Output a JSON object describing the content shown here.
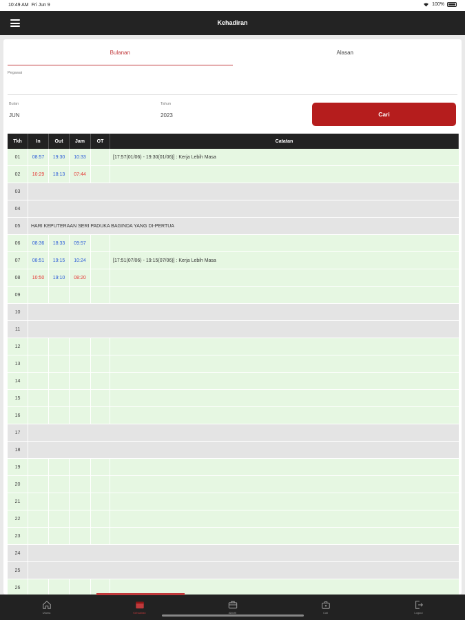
{
  "status": {
    "time": "10:49 AM",
    "date": "Fri Jun 9",
    "battery": "100%"
  },
  "header": {
    "title": "Kehadiran"
  },
  "tabs": [
    {
      "label": "Bulanan"
    },
    {
      "label": "Alasan"
    }
  ],
  "form": {
    "pegawai_label": "Pegawai",
    "pegawai_value": "",
    "bulan_label": "Bulan",
    "bulan_value": "JUN",
    "tahun_label": "Tahun",
    "tahun_value": "2023",
    "cari_label": "Cari"
  },
  "table": {
    "headers": {
      "tkh": "Tkh",
      "in": "In",
      "out": "Out",
      "jam": "Jam",
      "ot": "OT",
      "catatan": "Catatan"
    },
    "rows": [
      {
        "tkh": "01",
        "in": "08:57",
        "out": "19:30",
        "jam": "10:33",
        "ot": "",
        "catatan": "[17:57(01/06) - 19:30(01/06)] : Kerja Lebih Masa"
      },
      {
        "tkh": "02",
        "in": "10:29",
        "out": "18:13",
        "jam": "07:44",
        "ot": "",
        "catatan": ""
      },
      {
        "tkh": "03",
        "holiday": ""
      },
      {
        "tkh": "04",
        "holiday": ""
      },
      {
        "tkh": "05",
        "holiday": "HARI KEPUTERAAN SERI PADUKA BAGINDA YANG DI-PERTUA"
      },
      {
        "tkh": "06",
        "in": "08:36",
        "out": "18:33",
        "jam": "09:57",
        "ot": "",
        "catatan": ""
      },
      {
        "tkh": "07",
        "in": "08:51",
        "out": "19:15",
        "jam": "10:24",
        "ot": "",
        "catatan": "[17:51(07/06) - 19:15(07/06)] : Kerja Lebih Masa"
      },
      {
        "tkh": "08",
        "in": "10:50",
        "out": "19:10",
        "jam": "08:20",
        "ot": "",
        "catatan": ""
      },
      {
        "tkh": "09",
        "in": "",
        "out": "",
        "jam": "",
        "ot": "",
        "catatan": ""
      },
      {
        "tkh": "10",
        "holiday": ""
      },
      {
        "tkh": "11",
        "holiday": ""
      },
      {
        "tkh": "12",
        "in": "",
        "out": "",
        "jam": "",
        "ot": "",
        "catatan": ""
      },
      {
        "tkh": "13",
        "in": "",
        "out": "",
        "jam": "",
        "ot": "",
        "catatan": ""
      },
      {
        "tkh": "14",
        "in": "",
        "out": "",
        "jam": "",
        "ot": "",
        "catatan": ""
      },
      {
        "tkh": "15",
        "in": "",
        "out": "",
        "jam": "",
        "ot": "",
        "catatan": ""
      },
      {
        "tkh": "16",
        "in": "",
        "out": "",
        "jam": "",
        "ot": "",
        "catatan": ""
      },
      {
        "tkh": "17",
        "holiday": ""
      },
      {
        "tkh": "18",
        "holiday": ""
      },
      {
        "tkh": "19",
        "in": "",
        "out": "",
        "jam": "",
        "ot": "",
        "catatan": ""
      },
      {
        "tkh": "20",
        "in": "",
        "out": "",
        "jam": "",
        "ot": "",
        "catatan": ""
      },
      {
        "tkh": "21",
        "in": "",
        "out": "",
        "jam": "",
        "ot": "",
        "catatan": ""
      },
      {
        "tkh": "22",
        "in": "",
        "out": "",
        "jam": "",
        "ot": "",
        "catatan": ""
      },
      {
        "tkh": "23",
        "in": "",
        "out": "",
        "jam": "",
        "ot": "",
        "catatan": ""
      },
      {
        "tkh": "24",
        "holiday": ""
      },
      {
        "tkh": "25",
        "holiday": ""
      },
      {
        "tkh": "26",
        "in": "",
        "out": "",
        "jam": "",
        "ot": "",
        "catatan": ""
      }
    ]
  },
  "bottom_nav": [
    {
      "label": "Utama",
      "icon": "home-icon"
    },
    {
      "label": "Kehadiran",
      "icon": "calendar-icon"
    },
    {
      "label": "Aktiviti",
      "icon": "briefcase-icon"
    },
    {
      "label": "Cuti",
      "icon": "suitcase-icon"
    },
    {
      "label": "Logout",
      "icon": "logout-icon"
    }
  ],
  "colors": {
    "accent": "#b51d1d",
    "header_bg": "#232323",
    "work_row": "#e6f7e2",
    "off_row": "#e4e4e4",
    "time_blue": "#2a5bd7",
    "time_red": "#e53935"
  }
}
